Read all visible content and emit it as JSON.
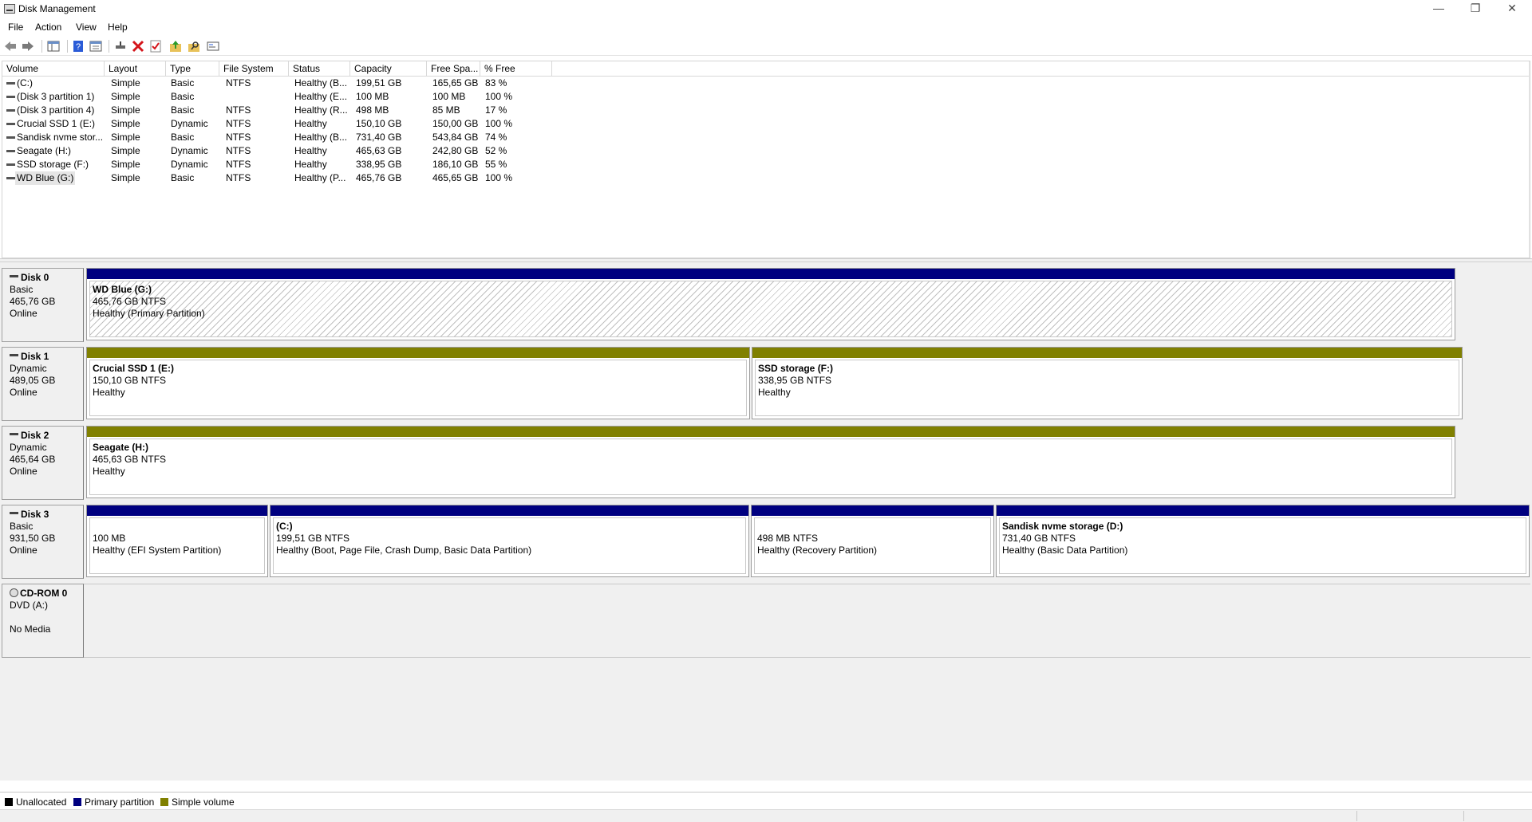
{
  "window": {
    "title": "Disk Management",
    "minimize": "—",
    "restore": "❐",
    "close": "✕"
  },
  "menu": [
    "File",
    "Action",
    "View",
    "Help"
  ],
  "toolbar": {
    "icons": [
      "back-arrow-icon",
      "forward-arrow-icon",
      "console-tree-icon",
      "help-icon",
      "properties-icon",
      "connect-disk-icon",
      "delete-icon",
      "check-icon",
      "folder-up-icon",
      "search-folder-icon",
      "settings-icon"
    ]
  },
  "volume_list": {
    "columns": [
      "Volume",
      "Layout",
      "Type",
      "File System",
      "Status",
      "Capacity",
      "Free Spa...",
      "% Free"
    ],
    "rows": [
      [
        "(C:)",
        "Simple",
        "Basic",
        "NTFS",
        "Healthy (B...",
        "199,51 GB",
        "165,65 GB",
        "83 %"
      ],
      [
        "(Disk 3 partition 1)",
        "Simple",
        "Basic",
        "",
        "Healthy (E...",
        "100 MB",
        "100 MB",
        "100 %"
      ],
      [
        "(Disk 3 partition 4)",
        "Simple",
        "Basic",
        "NTFS",
        "Healthy (R...",
        "498 MB",
        "85 MB",
        "17 %"
      ],
      [
        "Crucial SSD 1 (E:)",
        "Simple",
        "Dynamic",
        "NTFS",
        "Healthy",
        "150,10 GB",
        "150,00 GB",
        "100 %"
      ],
      [
        "Sandisk nvme stor...",
        "Simple",
        "Basic",
        "NTFS",
        "Healthy (B...",
        "731,40 GB",
        "543,84 GB",
        "74 %"
      ],
      [
        "Seagate (H:)",
        "Simple",
        "Dynamic",
        "NTFS",
        "Healthy",
        "465,63 GB",
        "242,80 GB",
        "52 %"
      ],
      [
        "SSD storage (F:)",
        "Simple",
        "Dynamic",
        "NTFS",
        "Healthy",
        "338,95 GB",
        "186,10 GB",
        "55 %"
      ],
      [
        "WD Blue (G:)",
        "Simple",
        "Basic",
        "NTFS",
        "Healthy (P...",
        "465,76 GB",
        "465,65 GB",
        "100 %"
      ]
    ]
  },
  "disks": [
    {
      "name": "Disk 0",
      "type": "Basic",
      "size": "465,76 GB",
      "state": "Online",
      "partitions": [
        {
          "title": "WD Blue  (G:)",
          "size": "465,76 GB NTFS",
          "status": "Healthy (Primary Partition)",
          "kind": "primary",
          "selected": true
        }
      ]
    },
    {
      "name": "Disk 1",
      "type": "Dynamic",
      "size": "489,05 GB",
      "state": "Online",
      "partitions": [
        {
          "title": "Crucial SSD 1  (E:)",
          "size": "150,10 GB NTFS",
          "status": "Healthy",
          "kind": "simple"
        },
        {
          "title": "SSD storage  (F:)",
          "size": "338,95 GB NTFS",
          "status": "Healthy",
          "kind": "simple"
        }
      ]
    },
    {
      "name": "Disk 2",
      "type": "Dynamic",
      "size": "465,64 GB",
      "state": "Online",
      "partitions": [
        {
          "title": "Seagate  (H:)",
          "size": "465,63 GB NTFS",
          "status": "Healthy",
          "kind": "simple"
        }
      ]
    },
    {
      "name": "Disk 3",
      "type": "Basic",
      "size": "931,50 GB",
      "state": "Online",
      "partitions": [
        {
          "title": "",
          "size": "100 MB",
          "status": "Healthy (EFI System Partition)",
          "kind": "primary"
        },
        {
          "title": "(C:)",
          "size": "199,51 GB NTFS",
          "status": "Healthy (Boot, Page File, Crash Dump, Basic Data Partition)",
          "kind": "primary"
        },
        {
          "title": "",
          "size": "498 MB NTFS",
          "status": "Healthy (Recovery Partition)",
          "kind": "primary"
        },
        {
          "title": "Sandisk nvme storage  (D:)",
          "size": "731,40 GB NTFS",
          "status": "Healthy (Basic Data Partition)",
          "kind": "primary"
        }
      ]
    }
  ],
  "cdrom": {
    "name": "CD-ROM 0",
    "drive": "DVD (A:)",
    "media": "No Media"
  },
  "legend": [
    {
      "label": "Unallocated",
      "color": "#000000"
    },
    {
      "label": "Primary partition",
      "color": "#000080"
    },
    {
      "label": "Simple volume",
      "color": "#808000"
    }
  ]
}
